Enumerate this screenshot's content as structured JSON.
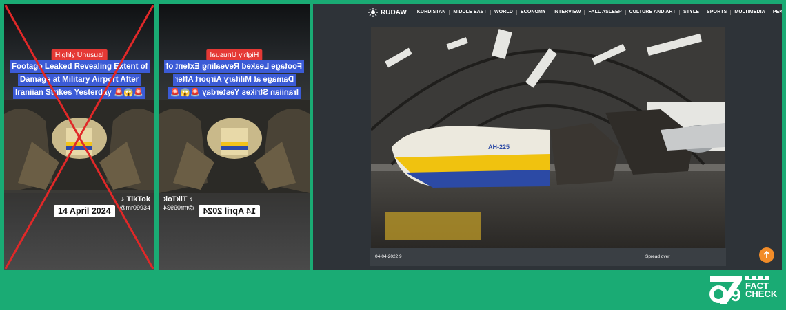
{
  "tiktok_post": {
    "tag": "Highly Unusual",
    "headline_lines": [
      "Footage Leaked Revealing Extent of",
      "Damage at Military Airport After",
      "Iraniian Strikes Yesterday 🚨😱🚨"
    ],
    "date": "14 April 2024",
    "brand": "TikTok",
    "handle": "@mr09934"
  },
  "rudaw": {
    "logo": "RUDAW",
    "nav": [
      "KURDISTAN",
      "MIDDLE EAST",
      "WORLD",
      "ECONOMY",
      "INTERVIEW",
      "FALL ASLEEP",
      "CULTURE AND ART",
      "STYLE",
      "SPORTS",
      "MULTIMEDIA",
      "PEKSH"
    ],
    "photo_text": "AH-225",
    "caption_date": "04-04-2022 9",
    "caption_spread": "Spread over"
  },
  "fact_check": {
    "number": "9",
    "word1": "FACT",
    "word2": "CHECK"
  },
  "colors": {
    "background": "#1aab74",
    "tag_red": "#e53935",
    "headline_blue": "#3b5bd6",
    "cross_red": "#e02828",
    "scroll_orange": "#f28c28"
  }
}
